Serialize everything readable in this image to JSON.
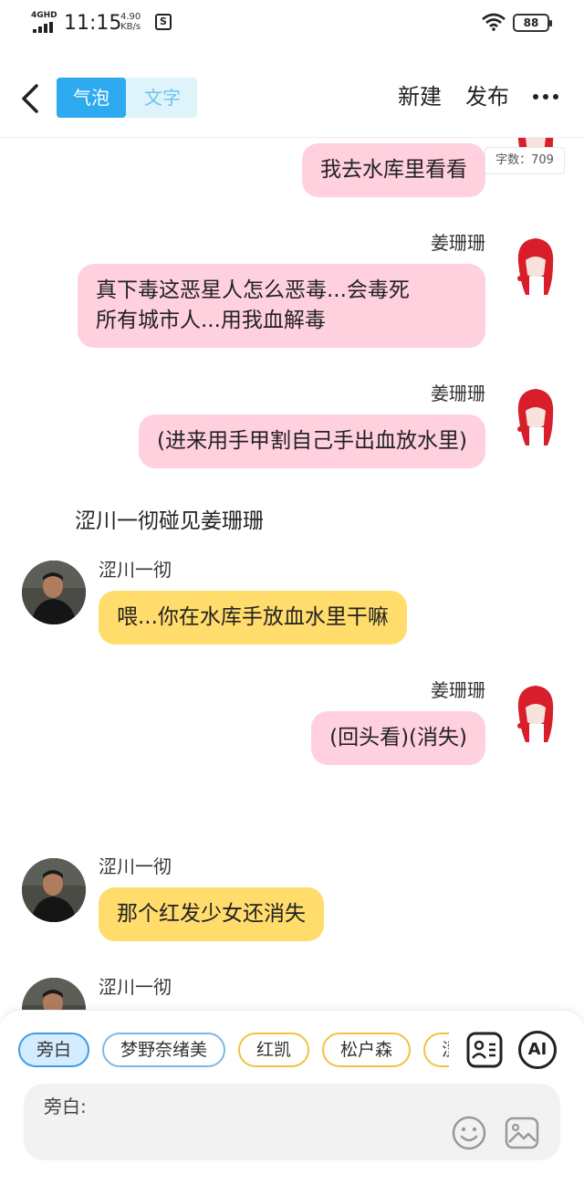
{
  "status_bar": {
    "network": "4GHD",
    "time": "11:15",
    "speed_value": "4.90",
    "speed_unit": "KB/s",
    "battery": "88"
  },
  "topnav": {
    "mode_bubble": "气泡",
    "mode_text": "文字",
    "new_label": "新建",
    "publish_label": "发布"
  },
  "word_count": "字数：709",
  "messages": [
    {
      "type": "bubble",
      "side": "right",
      "speaker": "",
      "text": "我去水库里看看"
    },
    {
      "type": "bubble",
      "side": "right",
      "speaker": "姜珊珊",
      "text_line1": "真下毒这恶星人怎么恶毒...会毒死",
      "text_line2": "所有城市人...用我血解毒"
    },
    {
      "type": "bubble",
      "side": "right",
      "speaker": "姜珊珊",
      "text": "(进来用手甲割自己手出血放水里)"
    },
    {
      "type": "narration",
      "text": "涩川一彻碰见姜珊珊"
    },
    {
      "type": "bubble",
      "side": "left",
      "speaker": "涩川一彻",
      "text": "喂...你在水库手放血水里干嘛"
    },
    {
      "type": "bubble",
      "side": "right",
      "speaker": "姜珊珊",
      "text": "(回头看)(消失)"
    },
    {
      "type": "bubble",
      "side": "left",
      "speaker": "涩川一彻",
      "text": "那个红发少女还消失"
    },
    {
      "type": "bubble",
      "side": "left",
      "speaker": "涩川一彻",
      "text": ""
    }
  ],
  "roles": [
    "旁白",
    "梦野奈绪美",
    "红凯",
    "松户森",
    "涩"
  ],
  "ai_label": "AI",
  "input": {
    "label": "旁白:"
  },
  "colors": {
    "accent": "#2eaaf0",
    "pink_bubble": "#ffd0dd",
    "yellow_bubble": "#ffdc6c"
  }
}
